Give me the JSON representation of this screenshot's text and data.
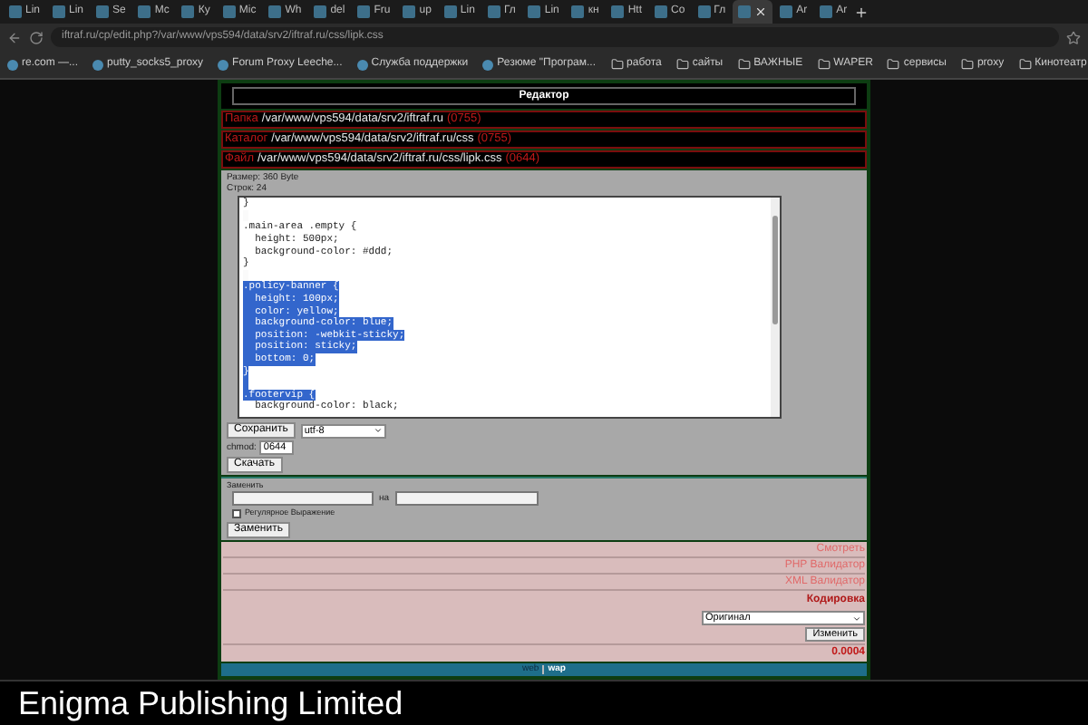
{
  "tabs": [
    {
      "label": "Lin",
      "selected": false
    },
    {
      "label": "Lin",
      "selected": false
    },
    {
      "label": "Se",
      "selected": false
    },
    {
      "label": "Mc",
      "selected": false
    },
    {
      "label": "Ку",
      "selected": false
    },
    {
      "label": "Mic",
      "selected": false
    },
    {
      "label": "Wh",
      "selected": false
    },
    {
      "label": "del",
      "selected": false
    },
    {
      "label": "Fru",
      "selected": false
    },
    {
      "label": "up",
      "selected": false
    },
    {
      "label": "Lin",
      "selected": false
    },
    {
      "label": "Гл",
      "selected": false
    },
    {
      "label": "Lin",
      "selected": false
    },
    {
      "label": "кн",
      "selected": false
    },
    {
      "label": "Htt",
      "selected": false
    },
    {
      "label": "Co",
      "selected": false
    },
    {
      "label": "Гл",
      "selected": false
    },
    {
      "selected": true
    },
    {
      "label": "Ar",
      "selected": false
    },
    {
      "label": "Ar",
      "selected": false
    }
  ],
  "address": "iftraf.ru/cp/edit.php?/var/www/vps594/data/srv2/iftraf.ru/css/lipk.css",
  "bookmarks": [
    {
      "label": "re.com —...",
      "kind": "page"
    },
    {
      "label": "putty_socks5_proxy",
      "kind": "page"
    },
    {
      "label": "Forum Proxy Leeche...",
      "kind": "page"
    },
    {
      "label": "Служба поддержки",
      "kind": "page"
    },
    {
      "label": "Резюме \"Програм...",
      "kind": "page"
    },
    {
      "label": "работа",
      "kind": "folder"
    },
    {
      "label": "сайты",
      "kind": "folder"
    },
    {
      "label": "ВАЖНЫЕ",
      "kind": "folder"
    },
    {
      "label": "WAPER",
      "kind": "folder"
    },
    {
      "label": "сервисы",
      "kind": "folder"
    },
    {
      "label": "proxy",
      "kind": "folder"
    },
    {
      "label": "Кинотеатр",
      "kind": "folder"
    }
  ],
  "editor": {
    "title": "Редактор",
    "paths": [
      {
        "label": "Папка",
        "path": "/var/www/vps594/data/srv2/iftraf.ru",
        "perm": "(0755)"
      },
      {
        "label": "Каталог",
        "path": "/var/www/vps594/data/srv2/iftraf.ru/css",
        "perm": "(0755)"
      },
      {
        "label": "Файл",
        "path": "/var/www/vps594/data/srv2/iftraf.ru/css/lipk.css",
        "perm": "(0644)"
      }
    ],
    "size": "Размер: 360 Byte",
    "lines_count": "Строк: 24",
    "code": [
      {
        "text": "}",
        "selected": false
      },
      {
        "selected": false
      },
      {
        "text": ".main-area .empty {",
        "selected": false
      },
      {
        "text": "  height: 500px;",
        "selected": false
      },
      {
        "text": "  background-color: #ddd;",
        "selected": false
      },
      {
        "text": "}",
        "selected": false
      },
      {
        "selected": false
      },
      {
        "text": ".policy-banner {",
        "selected": true
      },
      {
        "text": "  height: 100px;",
        "selected": true
      },
      {
        "text": "  color: yellow;",
        "selected": true
      },
      {
        "text": "  background-color: blue;",
        "selected": true
      },
      {
        "text": "  position: -webkit-sticky;",
        "selected": true
      },
      {
        "text": "  position: sticky;",
        "selected": true
      },
      {
        "text": "  bottom: 0;",
        "selected": true
      },
      {
        "text": "}",
        "selected": true
      },
      {
        "selected": true
      },
      {
        "text": ".footervip {",
        "selected": true
      },
      {
        "text": "  background-color: black;",
        "selected": false
      }
    ],
    "save_button": "Сохранить",
    "encoding_select": "utf-8",
    "chmod_label": "chmod:",
    "chmod_value": "0644",
    "download_button": "Скачать",
    "replace_label": "Заменить",
    "with_label": "на",
    "regex": {
      "label": "Регулярное Выражение",
      "checked": false
    },
    "replace_button": "Заменить",
    "links": [
      "Смотреть",
      "PHP Валидатор",
      "XML Валидатор"
    ],
    "encoding_heading": "Кодировка",
    "encoding_option": "Оригинал",
    "change_button": "Изменить",
    "timing": "0.0004",
    "footer": [
      "web",
      "wap"
    ]
  },
  "caption": "Enigma Publishing Limited"
}
